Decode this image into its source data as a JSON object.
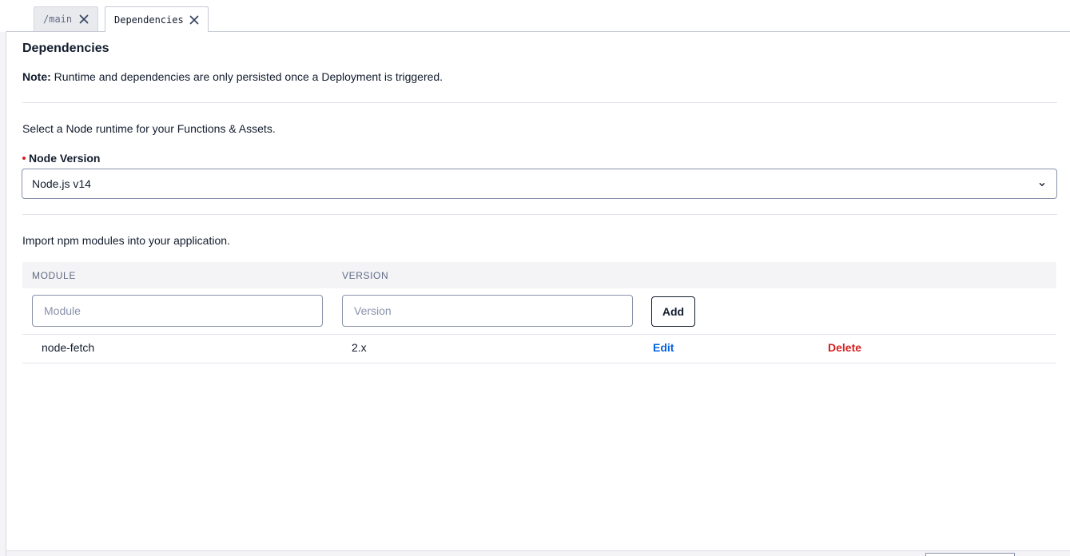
{
  "tabs": [
    {
      "label": "/main",
      "active": false
    },
    {
      "label": "Dependencies",
      "active": true
    }
  ],
  "panel": {
    "title": "Dependencies",
    "note_label": "Note:",
    "note_text": " Runtime and dependencies are only persisted once a Deployment is triggered.",
    "runtime_description": "Select a Node runtime for your Functions & Assets.",
    "node_version_label": "Node Version",
    "node_version_value": "Node.js v14",
    "npm_description": "Import npm modules into your application."
  },
  "table": {
    "columns": [
      "MODULE",
      "VERSION"
    ],
    "module_placeholder": "Module",
    "version_placeholder": "Version",
    "add_label": "Add",
    "rows": [
      {
        "module": "node-fetch",
        "version": "2.x",
        "edit_label": "Edit",
        "delete_label": "Delete"
      }
    ]
  },
  "colors": {
    "link_blue": "#0263e0",
    "danger_red": "#d61f1f",
    "text": "#121c2d",
    "muted": "#606b85"
  }
}
